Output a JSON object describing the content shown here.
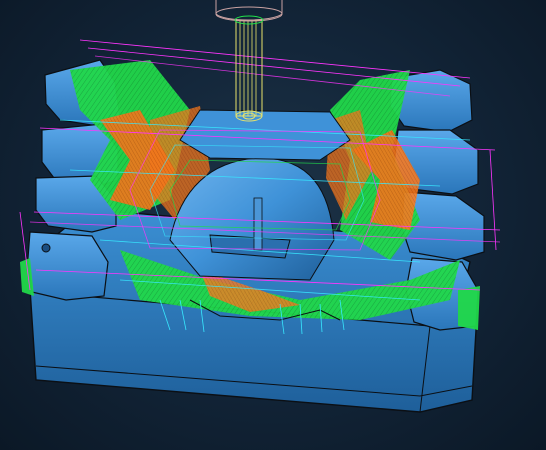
{
  "viewport": {
    "name": "cam-3d-viewport",
    "background": "#0c1b2b"
  },
  "colors": {
    "body": "#2f7fc4",
    "body_light": "#5aa6e6",
    "body_dark": "#1f5f99",
    "edge": "#0b0f14",
    "toolpath_green": "#22e34a",
    "toolpath_orange": "#ff7a1a",
    "toolpath_magenta": "#ff35ff",
    "toolpath_cyan": "#37e8ff",
    "tool": "#e8e36a",
    "holder": "#c9a2a2"
  },
  "icons": [
    "cutting-tool-icon",
    "tool-holder-icon"
  ]
}
